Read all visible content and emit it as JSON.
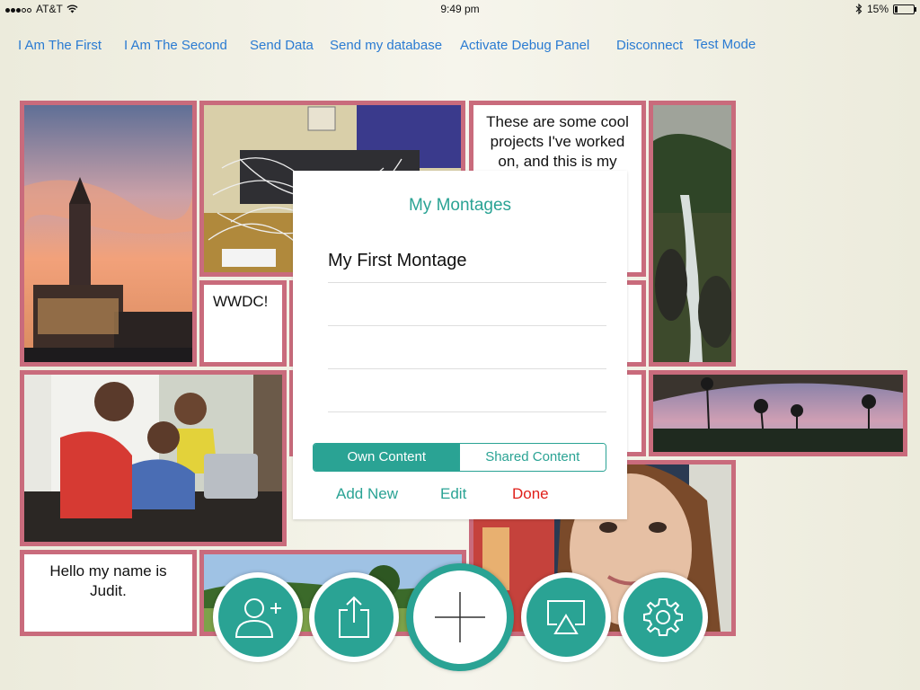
{
  "status_bar": {
    "carrier": "AT&T",
    "time": "9:49 pm",
    "battery": "15%",
    "battery_level": 0.15
  },
  "nav": {
    "links": [
      "I Am The First",
      "I Am The Second",
      "Send Data",
      "Send my database",
      "Activate Debug Panel",
      "Disconnect",
      "Test Mode"
    ]
  },
  "tiles": {
    "intro_text": "These are some cool projects I've worked on, and this is my",
    "wwdc_text": "WWDC!",
    "hello_text": "Hello my name is Judit."
  },
  "modal": {
    "title": "My Montages",
    "montages": [
      "My First Montage",
      "",
      "",
      ""
    ],
    "segments": {
      "own": "Own Content",
      "shared": "Shared Content",
      "selected": "Own Content"
    },
    "actions": {
      "add_new": "Add New",
      "edit": "Edit",
      "done": "Done"
    }
  },
  "toolbar": {
    "buttons": [
      "add-user-icon",
      "share-icon",
      "plus-icon",
      "airplay-icon",
      "gear-icon"
    ]
  },
  "colors": {
    "accent": "#2aa394",
    "tile_border": "#c96b7c",
    "link": "#2a7bd2",
    "done": "#e0201a"
  }
}
